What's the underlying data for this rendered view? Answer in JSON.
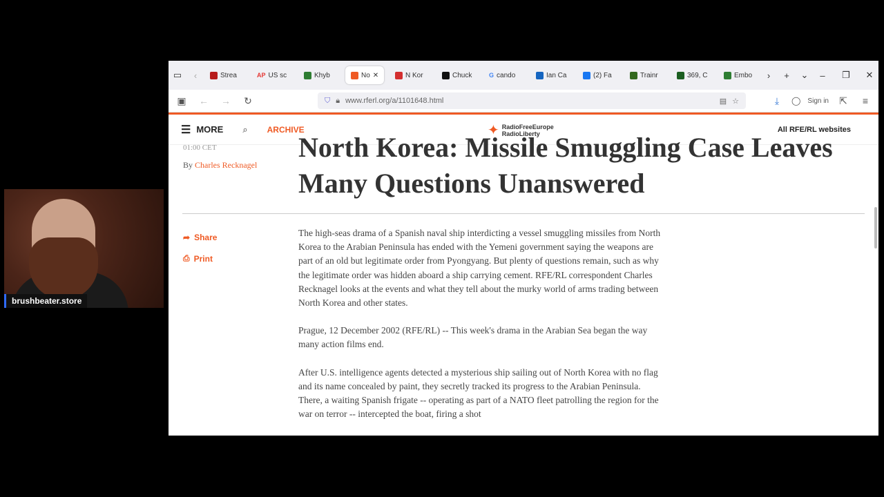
{
  "webcam": {
    "caption": "brushbeater.store"
  },
  "tabs": [
    {
      "label": "Strea",
      "color": "#b71c1c"
    },
    {
      "label": "US sc",
      "icon_text": "AP",
      "color": "#e53935"
    },
    {
      "label": "Khyb",
      "color": "#2e7d32"
    },
    {
      "label": "No",
      "color": "#ef5a24",
      "active": true
    },
    {
      "label": "N Kor",
      "color": "#d32f2f"
    },
    {
      "label": "Chuck",
      "color": "#111111"
    },
    {
      "label": "cando",
      "icon_text": "G",
      "color": "#4285f4"
    },
    {
      "label": "Ian Ca",
      "color": "#1565c0"
    },
    {
      "label": "(2) Fa",
      "color": "#1877f2"
    },
    {
      "label": "Trainr",
      "color": "#33691e"
    },
    {
      "label": "369, C",
      "color": "#1b5e20"
    },
    {
      "label": "Embo",
      "color": "#2e7d32"
    }
  ],
  "browser": {
    "url": "www.rferl.org/a/1101648.html",
    "sign_in": "Sign in"
  },
  "site": {
    "more": "MORE",
    "archive": "ARCHIVE",
    "logo_line1": "RadioFreeEurope",
    "logo_line2": "RadioLiberty",
    "all_sites": "All RFE/RL websites"
  },
  "article": {
    "time": "01:00 CET",
    "by": "By",
    "author": "Charles Recknagel",
    "title": "North Korea: Missile Smuggling Case Leaves Many Questions Unanswered",
    "share": "Share",
    "print": "Print",
    "paragraphs": [
      "The high-seas drama of a Spanish naval ship interdicting a vessel smuggling missiles from North Korea to the Arabian Peninsula has ended with the Yemeni government saying the weapons are part of an old but legitimate order from Pyongyang. But plenty of questions remain, such as why the legitimate order was hidden aboard a ship carrying cement. RFE/RL correspondent Charles Recknagel looks at the events and what they tell about the murky world of arms trading between North Korea and other states.",
      "Prague, 12 December 2002 (RFE/RL) -- This week's drama in the Arabian Sea began the way many action films end.",
      "After U.S. intelligence agents detected a mysterious ship sailing out of North Korea with no flag and its name concealed by paint, they secretly tracked its progress to the Arabian Peninsula. There, a waiting Spanish frigate -- operating as part of a NATO fleet patrolling the region for the war on terror -- intercepted the boat, firing a shot"
    ]
  }
}
